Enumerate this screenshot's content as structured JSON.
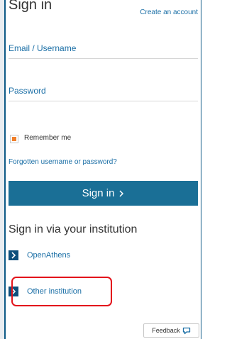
{
  "header": {
    "title": "Sign in",
    "create_account": "Create an account"
  },
  "form": {
    "email_label": "Email / Username",
    "password_label": "Password",
    "remember_label": "Remember me",
    "remember_checked": true,
    "forgot_link": "Forgotten username or password?",
    "submit_label": "Sign in",
    "submit_icon": "chevron-right-icon"
  },
  "institution": {
    "title": "Sign in via your institution",
    "options": [
      {
        "label": "OpenAthens",
        "icon": "chevron-right-icon"
      },
      {
        "label": "Other institution",
        "icon": "chevron-right-icon",
        "highlighted": true
      }
    ]
  },
  "feedback": {
    "label": "Feedback",
    "icon": "speech-bubble-icon"
  },
  "colors": {
    "primary_button": "#1a6f96",
    "link": "#1b6fa6",
    "checkbox_fill": "#f07f2a",
    "highlight_border": "#e3131b"
  }
}
